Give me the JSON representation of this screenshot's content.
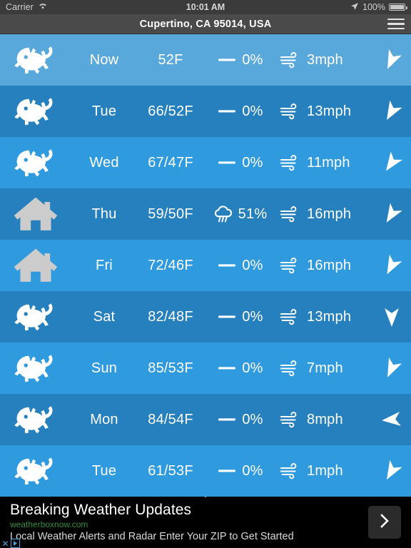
{
  "statusbar": {
    "carrier": "Carrier",
    "wifi_icon": "wifi-icon",
    "time": "10:01 AM",
    "location_icon": "location-arrow-icon",
    "battery_percent": "100%",
    "battery_icon": "battery-full-icon"
  },
  "navbar": {
    "title": "Cupertino, CA 95014, USA",
    "menu_icon": "hamburger-menu-icon"
  },
  "forecast": {
    "rows": [
      {
        "condition_icon": "fish-icon",
        "condition_state": "good",
        "day": "Now",
        "temp": "52F",
        "precip_icon": "no-precipitation-icon",
        "precip": "0%",
        "wind_icon": "wind-icon",
        "wind": "3mph",
        "direction_icon": "wind-direction-arrow-icon",
        "direction_deg": 205
      },
      {
        "condition_icon": "fish-icon",
        "condition_state": "good",
        "day": "Tue",
        "temp": "66/52F",
        "precip_icon": "no-precipitation-icon",
        "precip": "0%",
        "wind_icon": "wind-icon",
        "wind": "13mph",
        "direction_icon": "wind-direction-arrow-icon",
        "direction_deg": 210
      },
      {
        "condition_icon": "fish-icon",
        "condition_state": "good",
        "day": "Wed",
        "temp": "67/47F",
        "precip_icon": "no-precipitation-icon",
        "precip": "0%",
        "wind_icon": "wind-icon",
        "wind": "11mph",
        "direction_icon": "wind-direction-arrow-icon",
        "direction_deg": 215
      },
      {
        "condition_icon": "house-icon",
        "condition_state": "poor",
        "day": "Thu",
        "temp": "59/50F",
        "precip_icon": "rain-cloud-icon",
        "precip": "51%",
        "wind_icon": "wind-icon",
        "wind": "16mph",
        "direction_icon": "wind-direction-arrow-icon",
        "direction_deg": 212
      },
      {
        "condition_icon": "house-icon",
        "condition_state": "poor",
        "day": "Fri",
        "temp": "72/46F",
        "precip_icon": "no-precipitation-icon",
        "precip": "0%",
        "wind_icon": "wind-icon",
        "wind": "16mph",
        "direction_icon": "wind-direction-arrow-icon",
        "direction_deg": 208
      },
      {
        "condition_icon": "fish-icon",
        "condition_state": "good",
        "day": "Sat",
        "temp": "82/48F",
        "precip_icon": "no-precipitation-icon",
        "precip": "0%",
        "wind_icon": "wind-icon",
        "wind": "13mph",
        "direction_icon": "wind-direction-arrow-icon",
        "direction_deg": 180
      },
      {
        "condition_icon": "fish-icon",
        "condition_state": "good",
        "day": "Sun",
        "temp": "85/53F",
        "precip_icon": "no-precipitation-icon",
        "precip": "0%",
        "wind_icon": "wind-icon",
        "wind": "7mph",
        "direction_icon": "wind-direction-arrow-icon",
        "direction_deg": 205
      },
      {
        "condition_icon": "fish-icon",
        "condition_state": "good",
        "day": "Mon",
        "temp": "84/54F",
        "precip_icon": "no-precipitation-icon",
        "precip": "0%",
        "wind_icon": "wind-icon",
        "wind": "8mph",
        "direction_icon": "wind-direction-arrow-icon",
        "direction_deg": 265
      },
      {
        "condition_icon": "fish-icon",
        "condition_state": "good",
        "day": "Tue",
        "temp": "61/53F",
        "precip_icon": "no-precipitation-icon",
        "precip": "0%",
        "wind_icon": "wind-icon",
        "wind": "1mph",
        "direction_icon": "wind-direction-arrow-icon",
        "direction_deg": 210
      }
    ]
  },
  "ad": {
    "title": "Breaking Weather Updates",
    "url": "weatherboxnow.com",
    "description": "Local Weather Alerts and Radar Enter Your ZIP to Get Started",
    "cta_icon": "chevron-right-icon",
    "close_label": "✕",
    "close_icon": "close-ad-icon",
    "adchoices_icon": "adchoices-icon"
  },
  "colors": {
    "row_now": "#58a8dc",
    "row_even": "#2f9ade",
    "row_odd": "#2580bd",
    "navbar": "#4a4a4a",
    "statusbar": "#3b3b3b",
    "ad_background": "#000000",
    "ad_url": "#2f8f3f",
    "condition_poor": "#cccccc",
    "condition_good": "#ffffff"
  }
}
